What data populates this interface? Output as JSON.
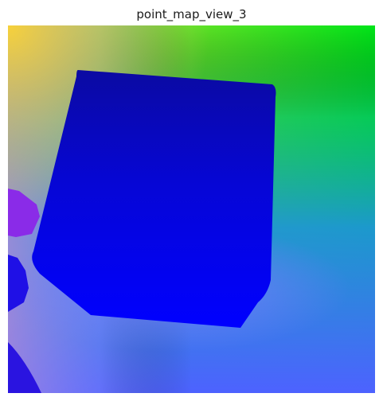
{
  "figure": {
    "title": "point_map_view_3"
  },
  "image": {
    "icon": "point-map-visualization",
    "colors": {
      "corner_top_left": "#f7d13a",
      "corner_top_right": "#00e31a",
      "field_mid_right": "#0aa87a",
      "field_lower_right": "#2a86e8",
      "field_bottom": "#5a6cff",
      "field_left": "#9a8cf0",
      "cube_top": "#0a0aa8",
      "cube_bottom": "#0000ff",
      "left_object": "#8a2be8",
      "dark_object": "#1f10e6"
    }
  }
}
